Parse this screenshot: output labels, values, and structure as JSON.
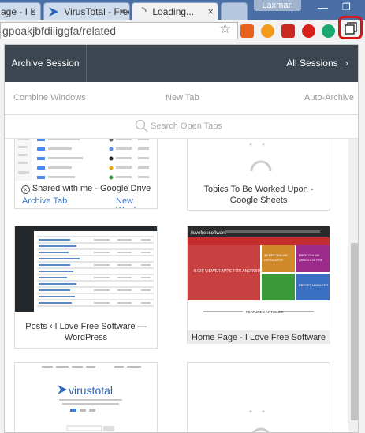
{
  "browser": {
    "tabs": [
      {
        "label": "age - I L"
      },
      {
        "label": "VirusTotal - Free"
      },
      {
        "label": "Loading..."
      }
    ],
    "user": "Laxman",
    "address": "gpoakjbfdiiiggfa/related"
  },
  "popup": {
    "archive_session": "Archive Session",
    "all_sessions": "All Sessions",
    "actions": {
      "combine": "Combine Windows",
      "new_tab": "New Tab",
      "auto_archive": "Auto-Archive"
    },
    "search_placeholder": "Search Open Tabs",
    "cards": [
      {
        "title": "Shared with me - Google Drive",
        "archive_link": "Archive Tab",
        "window_link": "New Window"
      },
      {
        "title": "Topics To Be Worked Upon - Google Sheets"
      },
      {
        "title": "Posts ‹ I Love Free Software — WordPress"
      },
      {
        "title": "Home Page - I Love Free Software"
      },
      {
        "title": ""
      },
      {
        "title": ""
      }
    ],
    "thumb_text": {
      "virustotal_logo": "virustotal",
      "ilfs_logo": "ilovefreesoftware",
      "ilfs_tiles": [
        "5 GIF VIEWER APPS FOR ANDROID",
        "3 FREE ONLINE ORGANIZER",
        "FREE ONLINE ANNOTATE PDF",
        "PRESET MANAGER",
        "FEATURED ARTICLES"
      ]
    }
  }
}
